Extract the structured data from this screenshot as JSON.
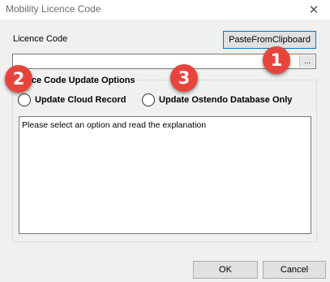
{
  "window": {
    "title": "Mobility Licence Code",
    "close_glyph": "✕"
  },
  "licence": {
    "label": "Licence Code",
    "paste_button": "PasteFromClipboard",
    "input_value": "",
    "ellipsis_label": "..."
  },
  "options_group": {
    "title": "Licence Code Update Options",
    "visible_title": "ence Code Update Options",
    "option_cloud": "Update Cloud Record",
    "option_ostendo": "Update Ostendo Database Only",
    "explanation": "Please select an option and read the explanation"
  },
  "footer": {
    "ok": "OK",
    "cancel": "Cancel"
  },
  "annotations": {
    "badge_1": "1",
    "badge_2": "2",
    "badge_3": "3",
    "badge_color": "#e8443e"
  }
}
